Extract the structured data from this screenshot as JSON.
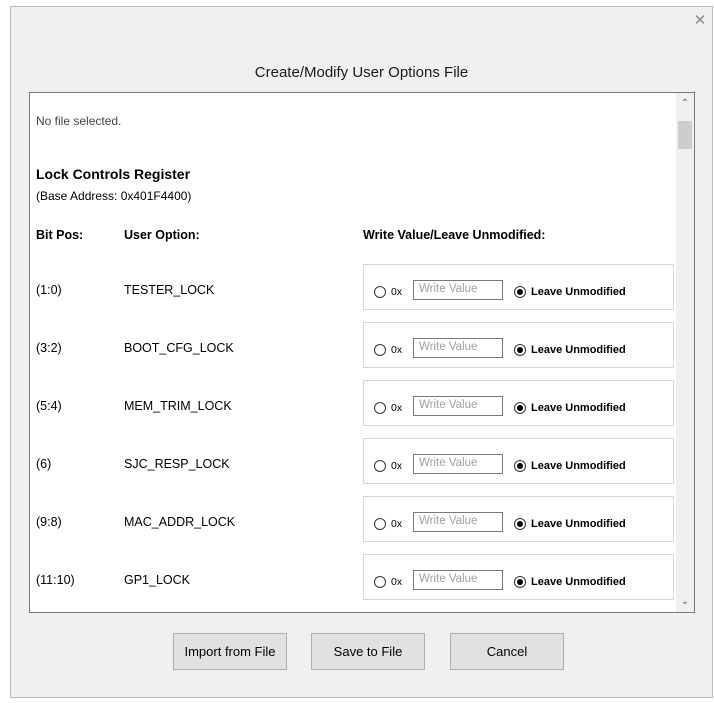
{
  "dialog": {
    "close_icon": "close-icon",
    "title": "Create/Modify User Options File"
  },
  "panel": {
    "status": "No file selected.",
    "section_title": "Lock Controls Register",
    "base_address": "(Base Address: 0x401F4400)",
    "headers": {
      "bit_pos": "Bit Pos:",
      "user_option": "User Option:",
      "write_value": "Write Value/Leave Unmodified:"
    },
    "rows": [
      {
        "bit_pos": "(1:0)",
        "option": "TESTER_LOCK",
        "hex_prefix": "0x",
        "write_placeholder": "Write Value",
        "leave_label": "Leave Unmodified",
        "selected": "leave"
      },
      {
        "bit_pos": "(3:2)",
        "option": "BOOT_CFG_LOCK",
        "hex_prefix": "0x",
        "write_placeholder": "Write Value",
        "leave_label": "Leave Unmodified",
        "selected": "leave"
      },
      {
        "bit_pos": "(5:4)",
        "option": "MEM_TRIM_LOCK",
        "hex_prefix": "0x",
        "write_placeholder": "Write Value",
        "leave_label": "Leave Unmodified",
        "selected": "leave"
      },
      {
        "bit_pos": "(6)",
        "option": "SJC_RESP_LOCK",
        "hex_prefix": "0x",
        "write_placeholder": "Write Value",
        "leave_label": "Leave Unmodified",
        "selected": "leave"
      },
      {
        "bit_pos": "(9:8)",
        "option": "MAC_ADDR_LOCK",
        "hex_prefix": "0x",
        "write_placeholder": "Write Value",
        "leave_label": "Leave Unmodified",
        "selected": "leave"
      },
      {
        "bit_pos": "(11:10)",
        "option": "GP1_LOCK",
        "hex_prefix": "0x",
        "write_placeholder": "Write Value",
        "leave_label": "Leave Unmodified",
        "selected": "leave"
      }
    ]
  },
  "buttons": {
    "import": "Import from File",
    "save": "Save to File",
    "cancel": "Cancel"
  },
  "scrollbar": {
    "up_icon": "chevron-up-icon",
    "down_icon": "chevron-down-icon"
  }
}
